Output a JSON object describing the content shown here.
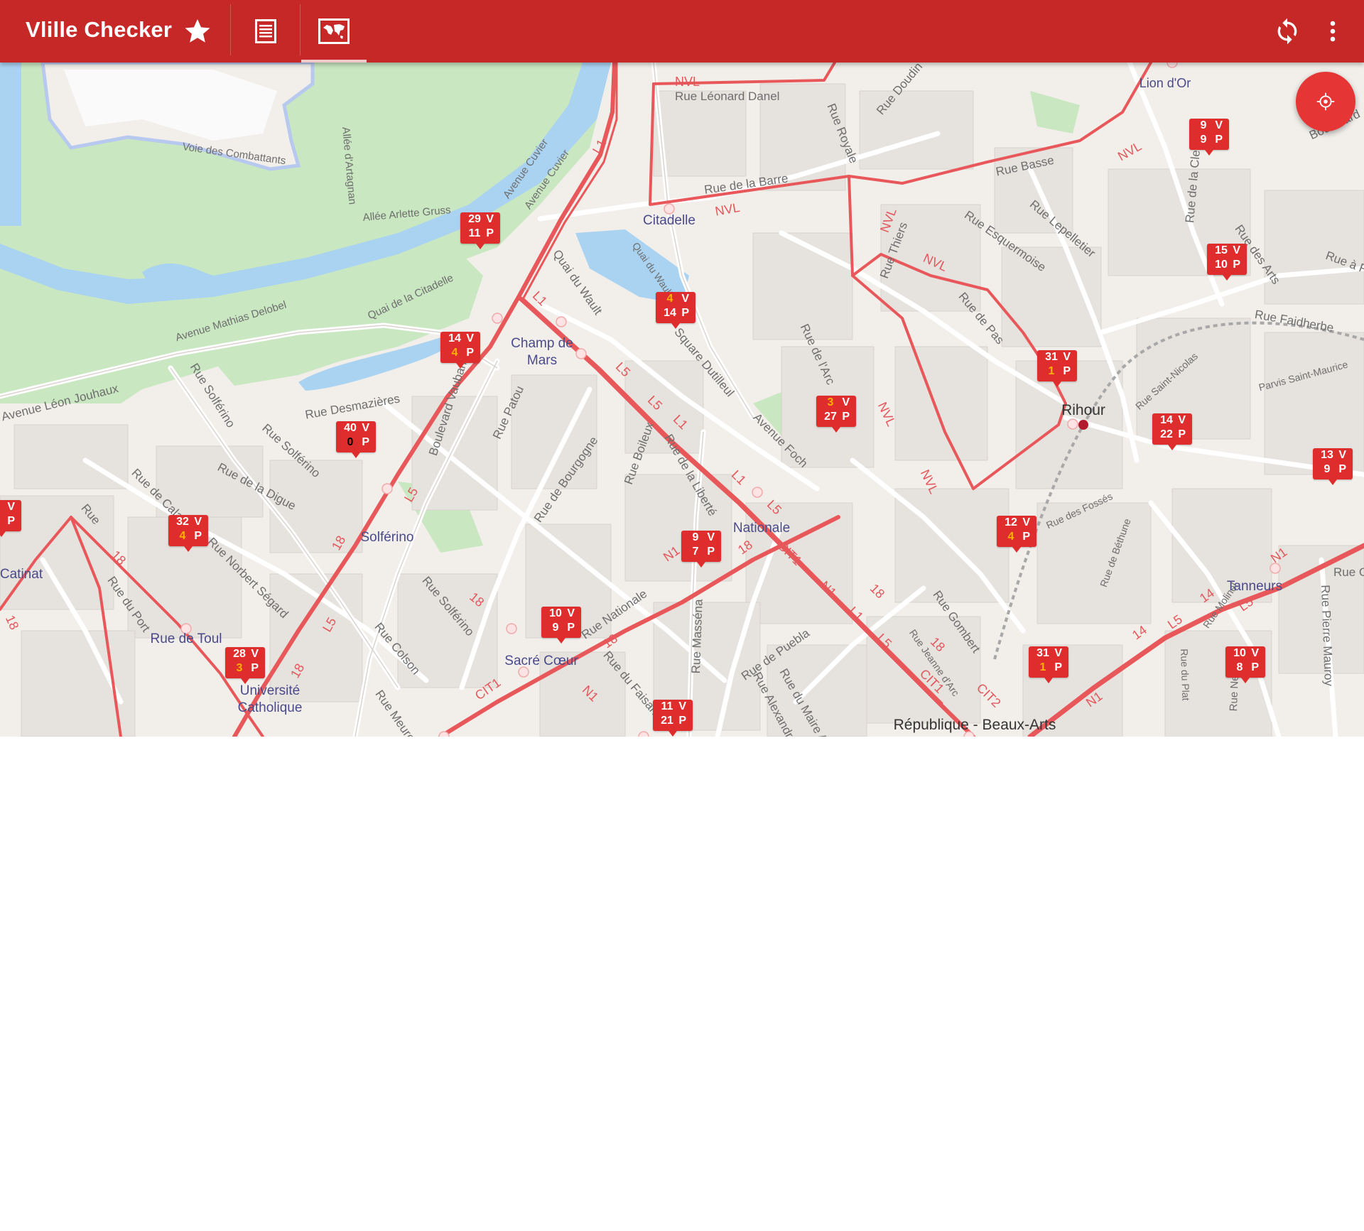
{
  "app": {
    "title": "Vlille Checker",
    "tabs": [
      {
        "name": "favorites",
        "icon": "star-icon"
      },
      {
        "name": "list",
        "icon": "list-icon"
      },
      {
        "name": "map",
        "icon": "map-icon",
        "selected": true
      }
    ],
    "actions": [
      {
        "name": "refresh",
        "icon": "refresh-icon"
      },
      {
        "name": "overflow-menu",
        "icon": "more-vert-icon"
      }
    ],
    "colors": {
      "appbar": "#c62828",
      "marker": "#df2d2d",
      "low_count": "#ffb300",
      "fab": "#e53535",
      "transit_line": "#e8585b"
    }
  },
  "map": {
    "locate_button_icon": "my-location-icon",
    "stations": [
      {
        "v": "29",
        "p": "11"
      },
      {
        "v": "4",
        "p": "14"
      },
      {
        "v": "14",
        "p": "4"
      },
      {
        "v": "40",
        "p": "0"
      },
      {
        "v": "3",
        "p": "27"
      },
      {
        "v": "9",
        "p": "9"
      },
      {
        "v": "15",
        "p": "10"
      },
      {
        "v": "31",
        "p": "1"
      },
      {
        "v": "14",
        "p": "22"
      },
      {
        "v": "13",
        "p": "9"
      },
      {
        "v": "",
        "p": ""
      },
      {
        "v": "32",
        "p": "4"
      },
      {
        "v": "12",
        "p": "4"
      },
      {
        "v": "9",
        "p": "7"
      },
      {
        "v": "10",
        "p": "9"
      },
      {
        "v": "28",
        "p": "3"
      },
      {
        "v": "31",
        "p": "1"
      },
      {
        "v": "10",
        "p": "8"
      },
      {
        "v": "11",
        "p": "21"
      }
    ],
    "marker_labels": {
      "v": "V",
      "p": "P"
    },
    "places": [
      "Lion d'Or",
      "Citadelle",
      "Champ de Mars",
      "Rihour",
      "Nationale",
      "Solférino",
      "Tanneurs",
      "Catinat",
      "Rue de Toul",
      "Sacré Cœur",
      "Université Catholique",
      "République - Beaux-Arts"
    ],
    "streets": [
      "Rue Léonard Danel",
      "Rue Royale",
      "Rue Doudin",
      "Voie des Combattants",
      "Allée d'Artagnan",
      "Avenue Cuvier",
      "Avenue Cuvier",
      "Allée Arlette Gruss",
      "Rue de la Barre",
      "Rue Basse",
      "Boulevard",
      "Rue de la Clef",
      "Rue Lepelletier",
      "Rue Esquermoise",
      "Rue Thiers",
      "Quai du Wault",
      "Quai du Wault",
      "Quai de la Citadelle",
      "Avenue Mathias Delobel",
      "Rue de Pas",
      "Rue des Arts",
      "Rue à Fiens",
      "Rue Faidherbe",
      "Square Dutilleul",
      "Rue de l'Arc",
      "Parvis Saint-Maurice",
      "Rue Saint-Nicolas",
      "Avenue Léon Jouhaux",
      "Rue Solférino",
      "Rue Desmazières",
      "Boulevard Vauban",
      "Rue Patou",
      "Avenue Foch",
      "Rue Solférino",
      "Rue de la Digue",
      "Rue de Calais",
      "Rue de Bourgogne",
      "Rue Boileux",
      "Rue de la Liberté",
      "Rue des Fossés",
      "Rue de Béthune",
      "Rue du Port",
      "Rue Norbert Ségard",
      "Rue Solférino",
      "Rue Nationale",
      "Rue Gombert",
      "Rue Pierre Mauroy",
      "Rue Colson",
      "Rue Masséna",
      "Rue de Puebla",
      "Rue du Faisan",
      "Rue Alexandre",
      "Rue du Maire André",
      "Rue du Plat",
      "Rue Molinel",
      "Rue Neuve",
      "Rue Meurein",
      "Rue",
      "Rue G",
      "Rue Jeanne d'Arc"
    ],
    "line_labels": [
      "NVL",
      "L1",
      "L5",
      "18",
      "CIT1",
      "CIT2",
      "N1",
      "14"
    ]
  }
}
